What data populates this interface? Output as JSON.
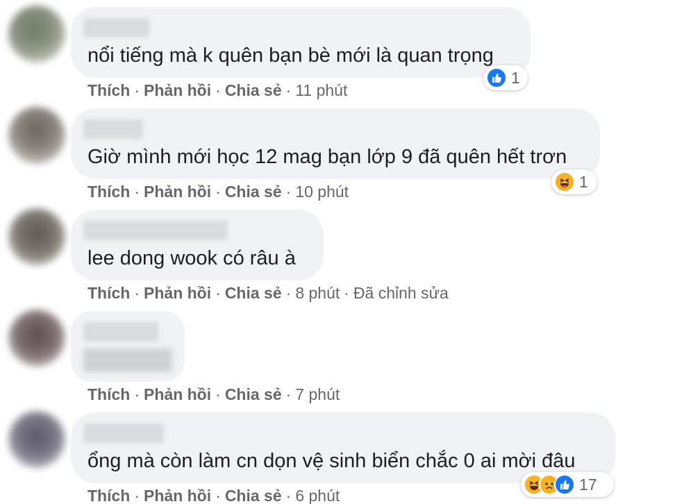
{
  "comments": [
    {
      "text": "nổi tiếng mà k quên bạn bè mới là quan trọng",
      "actions": {
        "like": "Thích",
        "reply": "Phản hồi",
        "share": "Chia sẻ",
        "time": "11 phút"
      },
      "reaction_count": "1",
      "reaction_icons": [
        "like-icon"
      ]
    },
    {
      "text": "Giờ mình mới học 12 mag bạn lớp 9 đã quên hết trơn",
      "actions": {
        "like": "Thích",
        "reply": "Phản hồi",
        "share": "Chia sẻ",
        "time": "10 phút"
      },
      "reaction_count": "1",
      "reaction_icons": [
        "haha-icon"
      ]
    },
    {
      "text": "lee dong wook có râu à",
      "actions": {
        "like": "Thích",
        "reply": "Phản hồi",
        "share": "Chia sẻ",
        "time": "8 phút",
        "edited": "Đã chỉnh sửa"
      }
    },
    {
      "text": "",
      "actions": {
        "like": "Thích",
        "reply": "Phản hồi",
        "share": "Chia sẻ",
        "time": "7 phút"
      }
    },
    {
      "text": "ổng mà còn làm cn dọn vệ sinh biển chắc 0 ai mời đâu",
      "actions": {
        "like": "Thích",
        "reply": "Phản hồi",
        "share": "Chia sẻ",
        "time": "6 phút"
      },
      "reaction_count": "17",
      "reaction_icons": [
        "haha-icon",
        "sad-icon",
        "like-icon"
      ]
    }
  ],
  "separator": "·",
  "colors": {
    "bubble": "#f0f2f5",
    "meta": "#65676b",
    "like": "#1877f2",
    "haha": "#f7b125"
  }
}
